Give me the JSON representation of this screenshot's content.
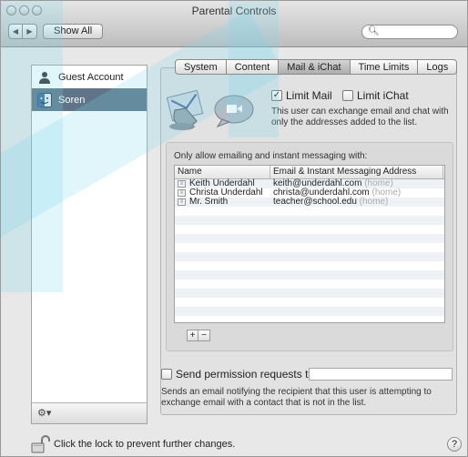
{
  "window": {
    "title": "Parental Controls"
  },
  "toolbar": {
    "show_all_label": "Show All",
    "back_icon": "chevron-left-icon",
    "forward_icon": "chevron-right-icon"
  },
  "search": {
    "value": "",
    "placeholder": "",
    "icon": "search-icon"
  },
  "sidebar": {
    "accounts": [
      {
        "label": "Guest Account",
        "icon": "user-silhouette-icon",
        "selected": false
      },
      {
        "label": "Soren",
        "icon": "finder-face-icon",
        "selected": true
      }
    ],
    "action_icon": "gear-icon"
  },
  "tabs": [
    {
      "label": "System",
      "active": false
    },
    {
      "label": "Content",
      "active": false
    },
    {
      "label": "Mail & iChat",
      "active": true
    },
    {
      "label": "Time Limits",
      "active": false
    },
    {
      "label": "Logs",
      "active": false
    }
  ],
  "options": {
    "limit_mail_label": "Limit Mail",
    "limit_mail_checked": true,
    "limit_ichat_label": "Limit iChat",
    "limit_ichat_checked": false,
    "description": "This user can exchange email and chat with only the addresses added to the list."
  },
  "contacts": {
    "group_label": "Only allow emailing and instant messaging with:",
    "columns": [
      "Name",
      "Email & Instant Messaging Address"
    ],
    "rows": [
      {
        "name": "Keith Underdahl",
        "address": "keith@underdahl.com",
        "tag": "(home)"
      },
      {
        "name": "Christa Underdahl",
        "address": "christa@underdahl.com",
        "tag": "(home)"
      },
      {
        "name": "Mr. Smith",
        "address": "teacher@school.edu",
        "tag": "(home)"
      }
    ],
    "add_label": "+",
    "remove_label": "−"
  },
  "permission": {
    "label": "Send permission requests to:",
    "checked": false,
    "value": "",
    "description": "Sends an email notifying the recipient that this user is attempting to exchange email with a contact that is not in the list."
  },
  "footer": {
    "lock_text": "Click the lock to prevent further changes.",
    "help_label": "?"
  },
  "colors": {
    "selection": "#5f7487",
    "watermark": "#7bd6ee"
  }
}
